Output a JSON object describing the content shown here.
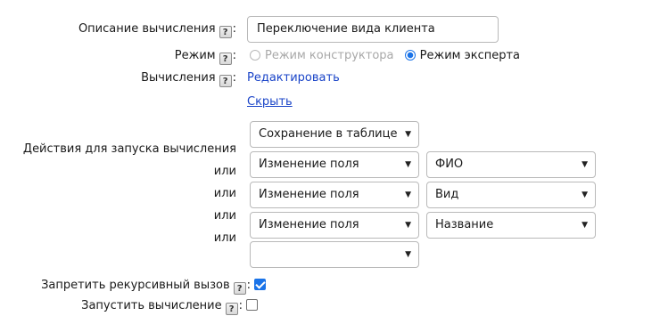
{
  "description": {
    "label": "Описание вычисления",
    "help": "?",
    "value": "Переключение вида клиента"
  },
  "mode": {
    "label": "Режим",
    "help": "?",
    "options": [
      {
        "label": "Режим конструктора",
        "selected": false,
        "disabled": true
      },
      {
        "label": "Режим эксперта",
        "selected": true,
        "disabled": false
      }
    ]
  },
  "calculations": {
    "label": "Вычисления",
    "help": "?",
    "edit_link": "Редактировать",
    "hide_link": "Скрыть"
  },
  "actions": {
    "label": "Действия для запуска вычисления",
    "or_label": "или",
    "rows": [
      {
        "action": "Сохранение в таблице",
        "field": null
      },
      {
        "action": "Изменение поля",
        "field": "ФИО"
      },
      {
        "action": "Изменение поля",
        "field": "Вид"
      },
      {
        "action": "Изменение поля",
        "field": "Название"
      },
      {
        "action": "",
        "field": null
      }
    ]
  },
  "forbid_recursive": {
    "label": "Запретить рекурсивный вызов",
    "help": "?",
    "checked": true
  },
  "run_calculation": {
    "label": "Запустить вычисление",
    "help": "?",
    "checked": false
  },
  "colors": {
    "accent": "#1a73e8",
    "link": "#1a44c8"
  }
}
